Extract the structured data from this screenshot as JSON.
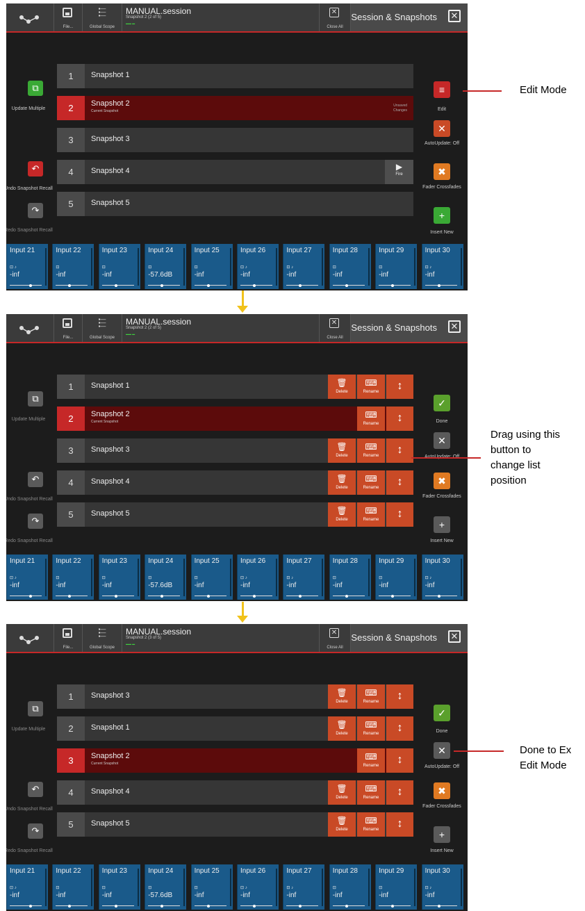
{
  "topbar": {
    "file_label": "File...",
    "global_scope_label": "Global Scope",
    "session_name": "MANUAL.session",
    "close_all_label": "Close All",
    "panel_title": "Session & Snapshots",
    "close_symbol": "✕"
  },
  "panels": [
    {
      "snapshot_info": "Snapshot 2 (2 of 5)",
      "left": {
        "update_multiple": "Update Multiple",
        "undo": "Undo Snapshot Recall",
        "redo": "Redo Snapshot Recall"
      },
      "snapshots": [
        {
          "num": "1",
          "name": "Snapshot 1"
        },
        {
          "num": "2",
          "name": "Snapshot 2",
          "sub": "Current Snapshot",
          "unsaved": "Unsaved Changes"
        },
        {
          "num": "3",
          "name": "Snapshot 3"
        },
        {
          "num": "4",
          "name": "Snapshot 4",
          "fire": "Fire"
        },
        {
          "num": "5",
          "name": "Snapshot 5"
        }
      ],
      "right": {
        "mode_label": "Edit",
        "autoupdate": "AutoUpdate: Off",
        "fader": "Fader Crossfades",
        "insert": "Insert New"
      }
    },
    {
      "snapshot_info": "Snapshot 2 (2 of 5)",
      "left": {
        "update_multiple": "Update Multiple",
        "undo": "Undo Snapshot Recall",
        "redo": "Redo Snapshot Recall"
      },
      "snapshots": [
        {
          "num": "1",
          "name": "Snapshot 1"
        },
        {
          "num": "2",
          "name": "Snapshot 2",
          "sub": "Current Snapshot"
        },
        {
          "num": "3",
          "name": "Snapshot 3"
        },
        {
          "num": "4",
          "name": "Snapshot 4"
        },
        {
          "num": "5",
          "name": "Snapshot 5"
        }
      ],
      "right": {
        "mode_label": "Done",
        "autoupdate": "AutoUpdate: Off",
        "fader": "Fader Crossfades",
        "insert": "Insert New"
      }
    },
    {
      "snapshot_info": "Snapshot 2 (3 of 5)",
      "left": {
        "update_multiple": "Update Multiple",
        "undo": "Undo Snapshot Recall",
        "redo": "Redo Snapshot Recall"
      },
      "snapshots": [
        {
          "num": "1",
          "name": "Snapshot 3"
        },
        {
          "num": "2",
          "name": "Snapshot 1"
        },
        {
          "num": "3",
          "name": "Snapshot 2",
          "sub": "Current Snapshot"
        },
        {
          "num": "4",
          "name": "Snapshot 4"
        },
        {
          "num": "5",
          "name": "Snapshot 5"
        }
      ],
      "right": {
        "mode_label": "Done",
        "autoupdate": "AutoUpdate: Off",
        "fader": "Fader Crossfades",
        "insert": "Insert New"
      }
    }
  ],
  "edit_buttons": {
    "delete": "Delete",
    "rename": "Rename"
  },
  "channels": [
    {
      "name": "Input 21",
      "icons": "⊡ ♪",
      "value": "-inf"
    },
    {
      "name": "Input 22",
      "icons": "⊡",
      "value": "-inf"
    },
    {
      "name": "Input 23",
      "icons": "⊡",
      "value": "-inf"
    },
    {
      "name": "Input 24",
      "icons": "⊡",
      "value": "-57.6dB"
    },
    {
      "name": "Input 25",
      "icons": "⊡",
      "value": "-inf"
    },
    {
      "name": "Input 26",
      "icons": "⊡ ♪",
      "value": "-inf"
    },
    {
      "name": "Input 27",
      "icons": "⊡ ♪",
      "value": "-inf"
    },
    {
      "name": "Input 28",
      "icons": "⊡",
      "value": "-inf"
    },
    {
      "name": "Input 29",
      "icons": "⊡",
      "value": "-inf"
    },
    {
      "name": "Input 30",
      "icons": "⊡ ♪",
      "value": "-inf"
    }
  ],
  "annotations": {
    "edit_mode": "Edit Mode",
    "drag": [
      "Drag using this",
      "button to",
      "change list",
      "position"
    ],
    "done": [
      "Done to Ex",
      "Edit Mode"
    ]
  },
  "colors": {
    "accent_red": "#c62828",
    "edit_orange": "#c94a26",
    "done_green": "#5aa02c",
    "update_green": "#3aa935",
    "channel_blue": "#1a5a8a",
    "arrow_yellow": "#f1c21b"
  }
}
